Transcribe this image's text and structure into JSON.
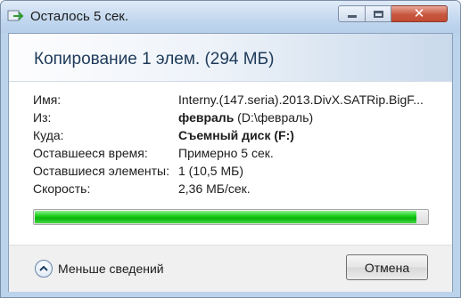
{
  "window": {
    "title": "Осталось 5 сек."
  },
  "dialog": {
    "heading": "Копирование 1 элем. (294 МБ)",
    "details": [
      {
        "label": "Имя:",
        "value": "Interny.(147.seria).2013.DivX.SATRip.BigF...",
        "bold": "",
        "suffix": ""
      },
      {
        "label": "Из:",
        "value": "",
        "bold": "февраль",
        "suffix": " (D:\\февраль)"
      },
      {
        "label": "Куда:",
        "value": "",
        "bold": "Съемный диск (F:)",
        "suffix": ""
      },
      {
        "label": "Оставшееся время:",
        "value": "Примерно 5 сек.",
        "bold": "",
        "suffix": ""
      },
      {
        "label": "Оставшиеся элементы:",
        "value": "1 (10,5 МБ)",
        "bold": "",
        "suffix": ""
      },
      {
        "label": "Скорость:",
        "value": "2,36 МБ/сек.",
        "bold": "",
        "suffix": ""
      }
    ],
    "progress": 0.972,
    "progress_color": "#1ed21e"
  },
  "footer": {
    "toggle_label": "Меньше сведений",
    "cancel_label": "Отмена"
  }
}
